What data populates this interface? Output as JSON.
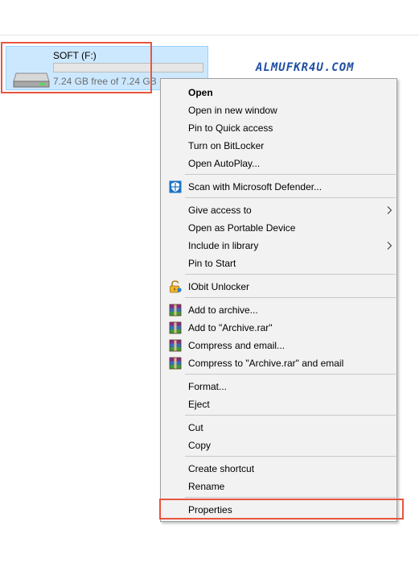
{
  "watermark": "ALMUFKR4U.COM",
  "drive": {
    "name": "SOFT (F:)",
    "free_text": "7.24 GB free of 7.24 GB",
    "used_fraction": 0.0
  },
  "menu": {
    "open": "Open",
    "open_new_window": "Open in new window",
    "pin_quick_access": "Pin to Quick access",
    "turn_on_bitlocker": "Turn on BitLocker",
    "open_autoplay": "Open AutoPlay...",
    "scan_defender": "Scan with Microsoft Defender...",
    "give_access": "Give access to",
    "open_portable": "Open as Portable Device",
    "include_library": "Include in library",
    "pin_start": "Pin to Start",
    "iobit_unlocker": "IObit Unlocker",
    "add_archive": "Add to archive...",
    "add_archive_rar": "Add to \"Archive.rar\"",
    "compress_email": "Compress and email...",
    "compress_rar_email": "Compress to \"Archive.rar\" and email",
    "format": "Format...",
    "eject": "Eject",
    "cut": "Cut",
    "copy": "Copy",
    "create_shortcut": "Create shortcut",
    "rename": "Rename",
    "properties": "Properties"
  },
  "colors": {
    "highlight": "#e8553f",
    "selection": "#cce8ff",
    "accent": "#26a0da"
  }
}
